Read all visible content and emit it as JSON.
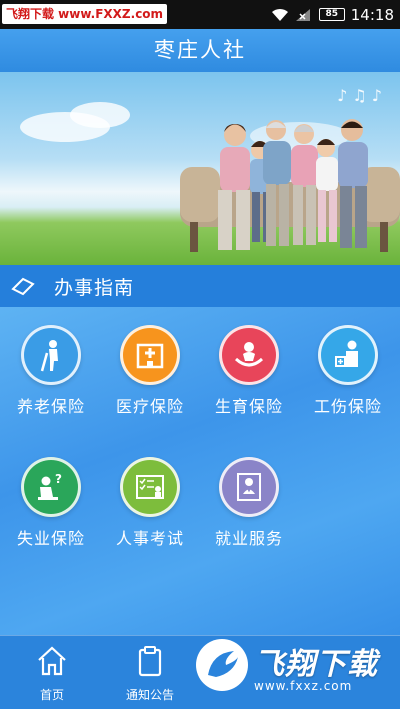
{
  "status_bar": {
    "watermark": "飞翔下载 www.FXXZ.com",
    "battery": "85",
    "time": "14:18",
    "icons": [
      "wifi-icon",
      "signal-icon",
      "battery-icon"
    ]
  },
  "header": {
    "title": "枣庄人社"
  },
  "banner": {
    "image": "family-photo"
  },
  "guide": {
    "title": "办事指南",
    "icon": "tag-icon"
  },
  "services": [
    {
      "label": "养老保险",
      "icon": "elderly-icon",
      "color": "#3a9ce6"
    },
    {
      "label": "医疗保险",
      "icon": "hospital-icon",
      "color": "#f7941d"
    },
    {
      "label": "生育保险",
      "icon": "baby-icon",
      "color": "#e8455a"
    },
    {
      "label": "工伤保险",
      "icon": "injury-icon",
      "color": "#35a7e8"
    },
    {
      "label": "失业保险",
      "icon": "unemployed-icon",
      "color": "#2aa65a"
    },
    {
      "label": "人事考试",
      "icon": "exam-icon",
      "color": "#7dbd3c"
    },
    {
      "label": "就业服务",
      "icon": "employment-icon",
      "color": "#8a84c8"
    }
  ],
  "bottom_nav": {
    "items": [
      {
        "label": "首页",
        "icon": "home-icon"
      },
      {
        "label": "通知公告",
        "icon": "notice-icon"
      }
    ]
  },
  "watermark_bottom": {
    "text": "飞翔下载",
    "url": "www.fxxz.com"
  }
}
